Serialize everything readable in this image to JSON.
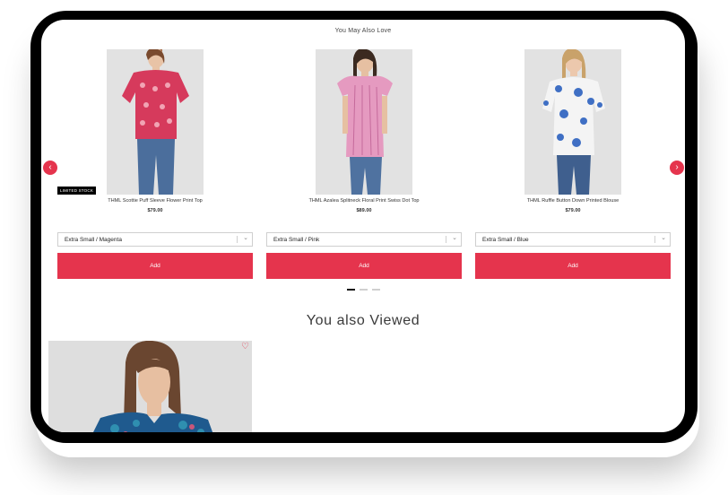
{
  "sections": {
    "recommended_title": "You May Also Love",
    "viewed_title": "You also Viewed"
  },
  "products": [
    {
      "name": "THML Scottie Puff Sleeve Flower Print Top",
      "price": "$79.00",
      "badge": "LIMITED STOCK",
      "variant": "Extra Small / Magenta",
      "add_label": "Add"
    },
    {
      "name": "THML Azalea Splitneck Floral Print Swiss Dot Top",
      "price": "$89.00",
      "variant": "Extra Small / Pink",
      "add_label": "Add"
    },
    {
      "name": "THML Ruffle Button Down Printed Blouse",
      "price": "$79.00",
      "variant": "Extra Small / Blue",
      "add_label": "Add"
    }
  ],
  "carousel": {
    "prev_icon": "‹",
    "next_icon": "›",
    "page_count": 3,
    "active_page": 1
  },
  "icons": {
    "chevron": "⌄",
    "heart": "♡"
  },
  "colors": {
    "accent": "#e5344d",
    "badge_bg": "#000000",
    "background": "#ffffff"
  }
}
